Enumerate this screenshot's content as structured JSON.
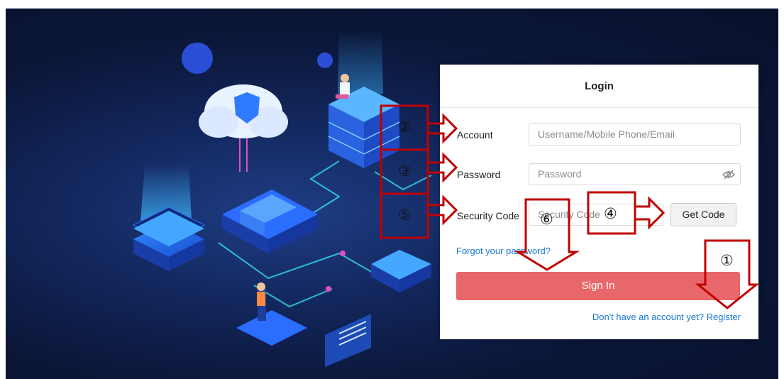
{
  "login": {
    "title": "Login",
    "account_label": "Account",
    "account_placeholder": "Username/Mobile Phone/Email",
    "password_label": "Password",
    "password_placeholder": "Password",
    "security_code_label": "Security Code",
    "security_code_placeholder": "Security Code",
    "get_code_label": "Get Code",
    "forgot_link": "Forgot your password?",
    "signin_label": "Sign In",
    "register_link": "Don't have an account yet? Register"
  },
  "annotations": {
    "markers": [
      "①",
      "②",
      "③",
      "④",
      "⑤",
      "⑥"
    ]
  },
  "colors": {
    "annotation_red": "#c00000",
    "signin_button": "#e8676a",
    "link_blue": "#1677d2",
    "hero_background": "#0b1638"
  },
  "icons": {
    "password_visibility": "eye-slash-icon"
  }
}
